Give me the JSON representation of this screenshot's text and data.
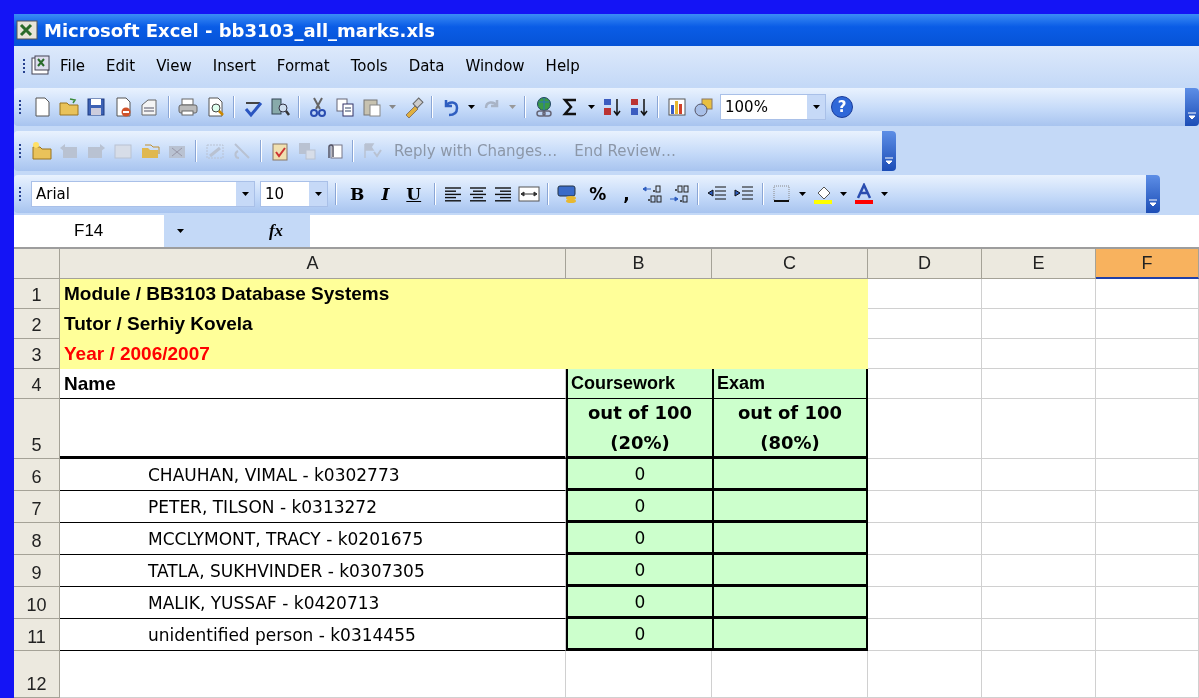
{
  "window": {
    "title": "Microsoft Excel - bb3103_all_marks.xls"
  },
  "menu": [
    {
      "label": "File"
    },
    {
      "label": "Edit"
    },
    {
      "label": "View"
    },
    {
      "label": "Insert"
    },
    {
      "label": "Format"
    },
    {
      "label": "Tools"
    },
    {
      "label": "Data"
    },
    {
      "label": "Window"
    },
    {
      "label": "Help"
    }
  ],
  "standard_toolbar": {
    "zoom": "100%",
    "help": "?"
  },
  "reviewing_toolbar": {
    "buttons": [
      {
        "label": "Reply with Changes…",
        "disabled": true
      },
      {
        "label": "End Review…",
        "disabled": true
      }
    ]
  },
  "formatting_toolbar": {
    "font": "Arial",
    "size": "10",
    "style_buttons": [
      "B",
      "I",
      "U"
    ],
    "number_buttons": [
      "%",
      ","
    ]
  },
  "formula_bar": {
    "name_box": "F14",
    "function_label": "fx"
  },
  "sheet": {
    "columns": [
      {
        "label": "A",
        "selected": false
      },
      {
        "label": "B",
        "selected": false
      },
      {
        "label": "C",
        "selected": false
      },
      {
        "label": "D",
        "selected": false
      },
      {
        "label": "E",
        "selected": false
      },
      {
        "label": "F",
        "selected": true
      }
    ],
    "rows": [
      {
        "number": "1",
        "kind": "banner",
        "color": "#000000",
        "cells": [
          "Module / BB3103 Database Systems"
        ]
      },
      {
        "number": "2",
        "kind": "banner",
        "color": "#000000",
        "cells": [
          "Tutor / Serhiy Kovela"
        ]
      },
      {
        "number": "3",
        "kind": "banner",
        "color": "#ff0000",
        "cells": [
          "Year / 2006/2007"
        ]
      },
      {
        "number": "4",
        "kind": "header",
        "cells": [
          "Name",
          "Coursework",
          "Exam"
        ]
      },
      {
        "number": "5",
        "kind": "subheader",
        "cells": [
          "",
          "out of 100\n(20%)",
          "out of 100\n(80%)"
        ]
      },
      {
        "number": "6",
        "kind": "student",
        "cells": [
          "CHAUHAN, VIMAL - k0302773",
          "0"
        ]
      },
      {
        "number": "7",
        "kind": "student",
        "cells": [
          "PETER, TILSON - k0313272",
          "0"
        ]
      },
      {
        "number": "8",
        "kind": "student",
        "cells": [
          "MCCLYMONT, TRACY - k0201675",
          "0"
        ]
      },
      {
        "number": "9",
        "kind": "student",
        "cells": [
          "TATLA, SUKHVINDER - k0307305",
          "0"
        ]
      },
      {
        "number": "10",
        "kind": "student",
        "cells": [
          "MALIK, YUSSAF - k0420713",
          "0"
        ]
      },
      {
        "number": "11",
        "kind": "student",
        "cells": [
          "unidentified person - k0314455",
          "0"
        ]
      },
      {
        "number": "12",
        "kind": "blank",
        "cells": []
      }
    ]
  }
}
